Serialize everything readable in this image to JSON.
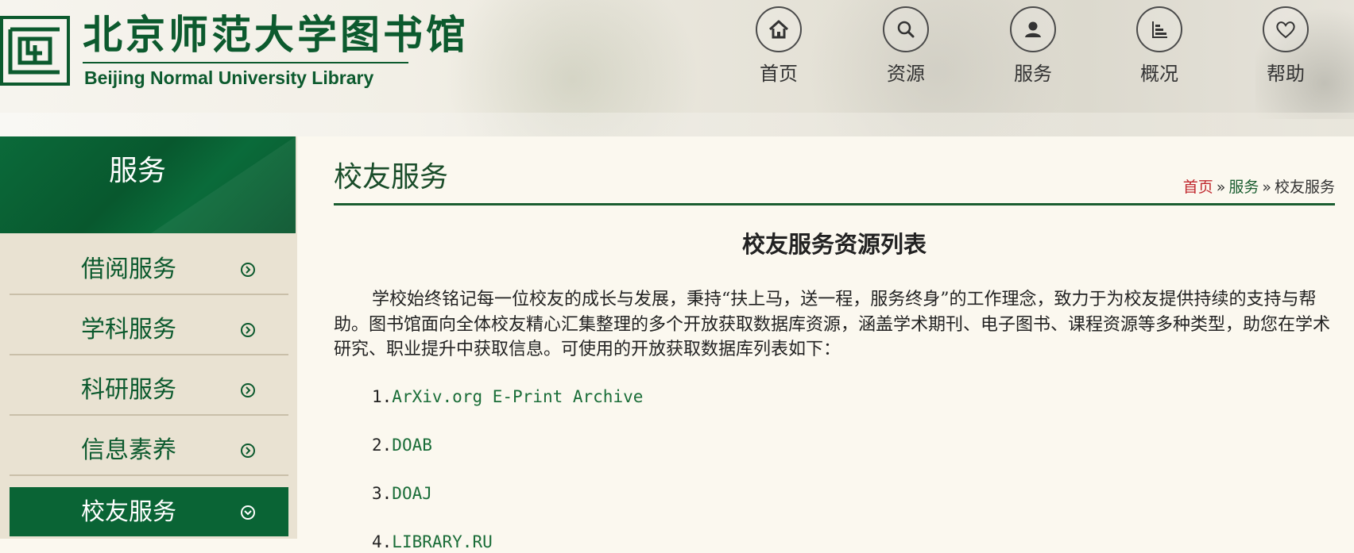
{
  "header": {
    "logo_cn": "北京师范大学图书馆",
    "logo_en": "Beijing Normal University Library",
    "nav": [
      {
        "label": "首页",
        "icon": "home-icon"
      },
      {
        "label": "资源",
        "icon": "search-icon"
      },
      {
        "label": "服务",
        "icon": "user-icon"
      },
      {
        "label": "概况",
        "icon": "chart-icon"
      },
      {
        "label": "帮助",
        "icon": "heart-icon"
      }
    ]
  },
  "sidebar": {
    "title": "服务",
    "items": [
      {
        "label": "借阅服务",
        "active": false
      },
      {
        "label": "学科服务",
        "active": false
      },
      {
        "label": "科研服务",
        "active": false
      },
      {
        "label": "信息素养",
        "active": false
      },
      {
        "label": "校友服务",
        "active": true
      }
    ]
  },
  "main": {
    "page_title": "校友服务",
    "breadcrumb": {
      "home": "首页",
      "separator": "»",
      "section": "服务",
      "current": "校友服务"
    },
    "content_heading": "校友服务资源列表",
    "intro": "学校始终铭记每一位校友的成长与发展，秉持“扶上马，送一程，服务终身”的工作理念，致力于为校友提供持续的支持与帮助。图书馆面向全体校友精心汇集整理的多个开放获取数据库资源，涵盖学术期刊、电子图书、课程资源等多种类型，助您在学术研究、职业提升中获取信息。可使用的开放获取数据库列表如下：",
    "list": [
      {
        "num": "1.",
        "name": "ArXiv.org E-Print Archive"
      },
      {
        "num": "2.",
        "name": "DOAB"
      },
      {
        "num": "3.",
        "name": "DOAJ"
      },
      {
        "num": "4.",
        "name": "LIBRARY.RU"
      }
    ]
  },
  "colors": {
    "brand_green": "#0c5a2e",
    "link_green": "#1a6d38",
    "breadcrumb_home_red": "#c0282e",
    "page_bg": "#fbf8ef",
    "sidebar_bg": "#e9e2d2"
  }
}
